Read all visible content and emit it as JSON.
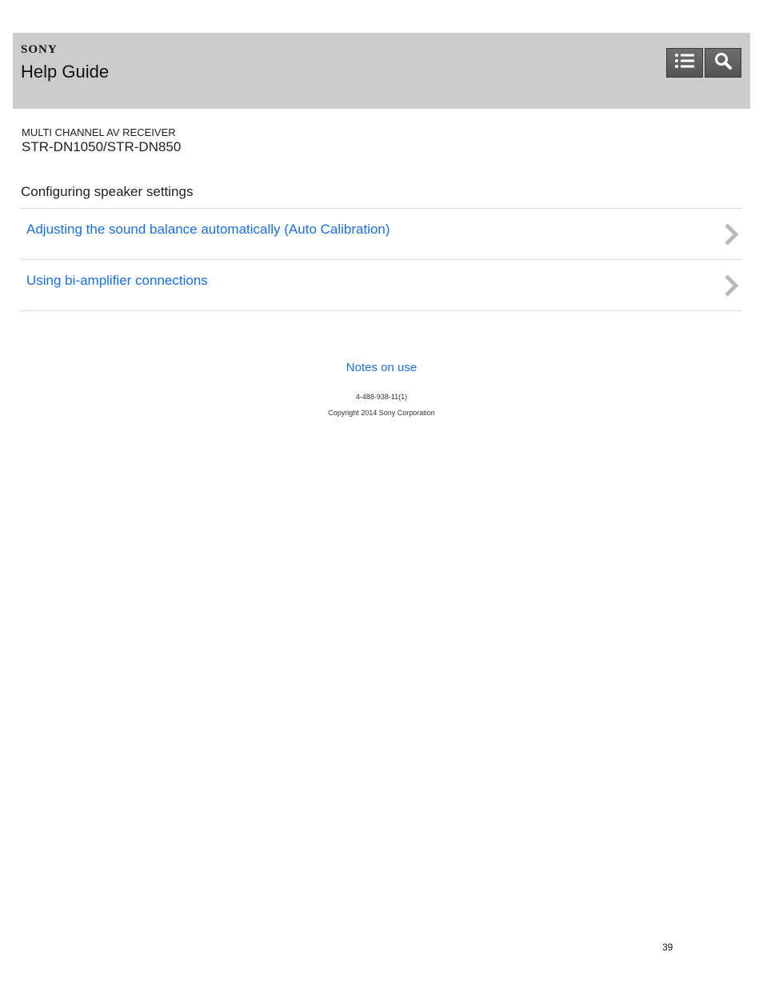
{
  "header": {
    "brand": "SONY",
    "title": "Help Guide",
    "toc_icon": "list-icon",
    "search_icon": "search-icon"
  },
  "product": {
    "type": "MULTI CHANNEL AV RECEIVER",
    "model": "STR-DN1050/STR-DN850"
  },
  "section": {
    "title": "Configuring speaker settings",
    "items": [
      {
        "label": "Adjusting the sound balance automatically (Auto Calibration)",
        "icon": "chevron-right-icon"
      },
      {
        "label": "Using bi-amplifier connections",
        "icon": "chevron-right-icon"
      }
    ]
  },
  "footer": {
    "notes_link": "Notes on use",
    "doc_code": "4-488-938-11(1)",
    "copyright": "Copyright 2014 Sony Corporation"
  },
  "page_number": "39",
  "colors": {
    "header_bg": "#cccccc",
    "link": "#1a6fe0",
    "button_bg": "#5f5f5f"
  }
}
